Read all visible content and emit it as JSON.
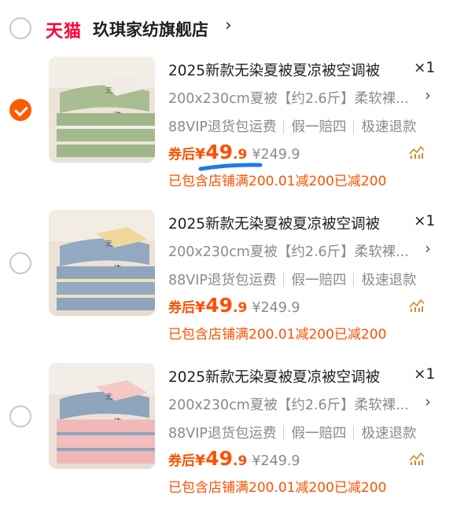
{
  "store": {
    "logo": "天猫",
    "name": "玖琪家纺旗舰店",
    "chevron": "›"
  },
  "items": [
    {
      "checked": true,
      "title": "2025新款无染夏被夏凉被空调被",
      "qty": "×1",
      "spec": "200x230cm夏被【约2.6斤】柔软裸...",
      "services": [
        "88VIP退货包运费",
        "假一赔四",
        "极速退款"
      ],
      "price_label": "券后",
      "price_currency": "¥",
      "price_int": "49",
      "price_dec": ".9",
      "original_price": "¥249.9",
      "promo": "已包含店铺满200.01减200已减200",
      "color": "green"
    },
    {
      "checked": false,
      "title": "2025新款无染夏被夏凉被空调被",
      "qty": "×1",
      "spec": "200x230cm夏被【约2.6斤】柔软裸...",
      "services": [
        "88VIP退货包运费",
        "假一赔四",
        "极速退款"
      ],
      "price_label": "券后",
      "price_currency": "¥",
      "price_int": "49",
      "price_dec": ".9",
      "original_price": "¥249.9",
      "promo": "已包含店铺满200.01减200已减200",
      "color": "blue"
    },
    {
      "checked": false,
      "title": "2025新款无染夏被夏凉被空调被",
      "qty": "×1",
      "spec": "200x230cm夏被【约2.6斤】柔软裸...",
      "services": [
        "88VIP退货包运费",
        "假一赔四",
        "极速退款"
      ],
      "price_label": "券后",
      "price_currency": "¥",
      "price_int": "49",
      "price_dec": ".9",
      "original_price": "¥249.9",
      "promo": "已包含店铺满200.01减200已减200",
      "color": "pink"
    }
  ],
  "colors": {
    "accent": "#ff5000",
    "tmall_red": "#ff0036",
    "checked_radio": "#ff5a00",
    "annotation_blue": "#1e7be0"
  },
  "icons": {
    "chevron": "chevron-right-icon",
    "trend": "price-trend-icon",
    "checkbox": "check-icon"
  }
}
